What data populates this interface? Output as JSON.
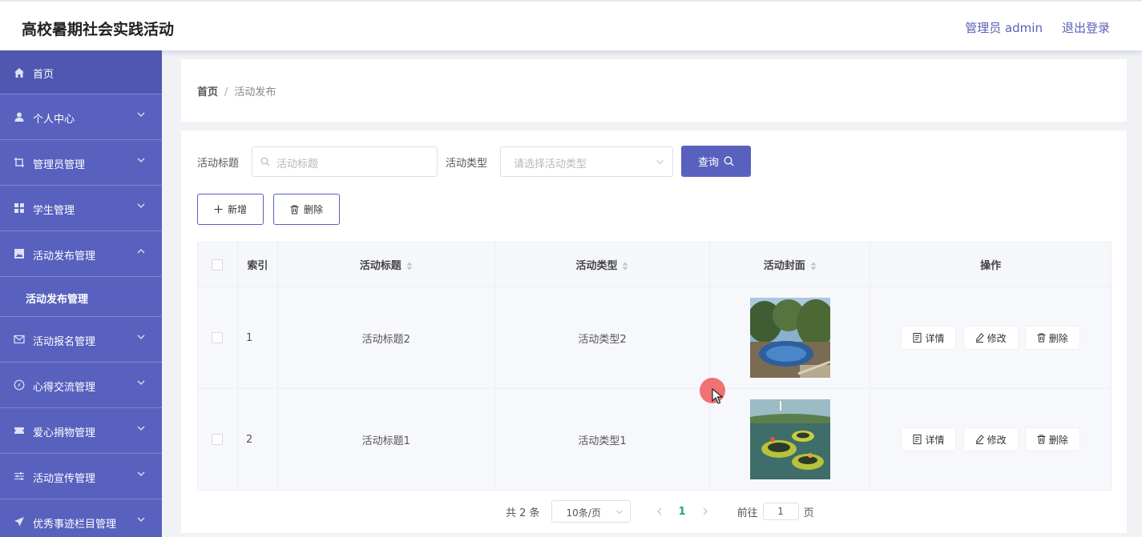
{
  "header": {
    "title": "高校暑期社会实践活动",
    "user": "管理员 admin",
    "logout": "退出登录"
  },
  "sidebar": {
    "items": [
      {
        "label": "首页",
        "icon": "home-icon"
      },
      {
        "label": "个人中心",
        "icon": "user-icon"
      },
      {
        "label": "管理员管理",
        "icon": "crop-icon"
      },
      {
        "label": "学生管理",
        "icon": "grid-icon"
      },
      {
        "label": "活动发布管理",
        "icon": "picture-icon",
        "expanded": true
      },
      {
        "label": "活动报名管理",
        "icon": "mail-icon"
      },
      {
        "label": "心得交流管理",
        "icon": "compass-icon"
      },
      {
        "label": "爱心捐物管理",
        "icon": "ticket-icon"
      },
      {
        "label": "活动宣传管理",
        "icon": "sliders-icon"
      },
      {
        "label": "优秀事迹栏目管理",
        "icon": "send-icon"
      }
    ],
    "subitem": "活动发布管理"
  },
  "breadcrumb": {
    "home": "首页",
    "separator": "/",
    "current": "活动发布"
  },
  "filters": {
    "title_label": "活动标题",
    "title_placeholder": "活动标题",
    "type_label": "活动类型",
    "type_placeholder": "请选择活动类型",
    "query_button": "查询"
  },
  "actions": {
    "add": "新增",
    "delete": "删除"
  },
  "table": {
    "columns": [
      "索引",
      "活动标题",
      "活动类型",
      "活动封面",
      "操作"
    ],
    "rows": [
      {
        "index": "1",
        "title": "活动标题2",
        "type": "活动类型2",
        "cover": "pool-photo"
      },
      {
        "index": "2",
        "title": "活动标题1",
        "type": "活动类型1",
        "cover": "trampoline-photo"
      }
    ],
    "row_actions": {
      "detail": "详情",
      "edit": "修改",
      "delete": "删除"
    }
  },
  "pagination": {
    "total": "共 2 条",
    "page_size": "10条/页",
    "current_page": "1",
    "goto_prefix": "前往",
    "goto_value": "1",
    "goto_suffix": "页"
  },
  "colors": {
    "sidebar": "#5961bf",
    "accent": "#5961bf",
    "page_active": "#2a9d8f"
  }
}
